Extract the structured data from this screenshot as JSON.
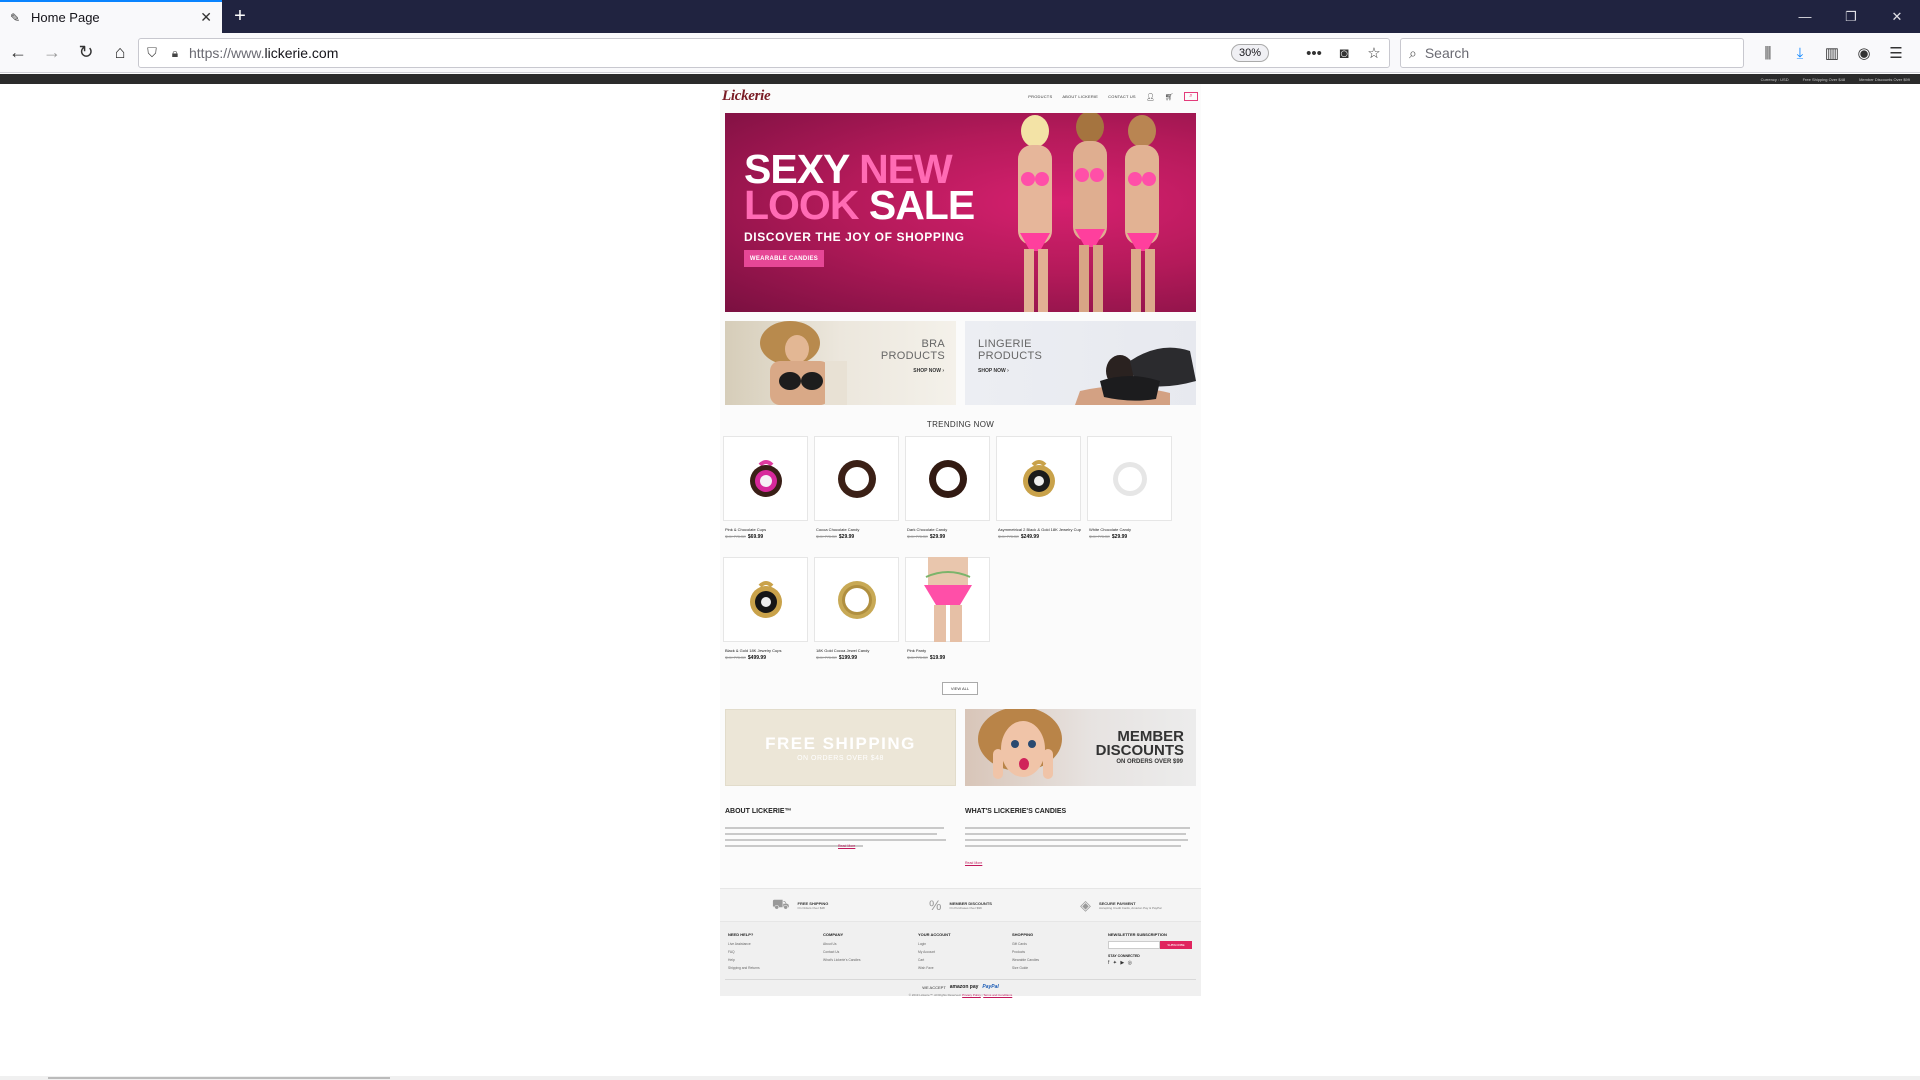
{
  "browser": {
    "tab_title": "Home Page",
    "url_prefix": "https://www.",
    "url_domain": "lickerie.com",
    "zoom": "30%",
    "search_placeholder": "Search"
  },
  "topbar": {
    "currency": "Currency : USD",
    "free_shipping": "Free Shipping Over $48",
    "member_discounts": "Member Discounts Over $99"
  },
  "site": {
    "logo": "Lickerie",
    "nav": [
      "PRODUCTS",
      "ABOUT LICKERIE",
      "CONTACT US"
    ],
    "hero": {
      "line1_a": "SEXY",
      "line1_b": "NEW",
      "line2_a": "LOOK",
      "line2_b": "SALE",
      "tagline": "DISCOVER THE JOY OF SHOPPING",
      "cta": "WEARABLE CANDIES"
    },
    "categories": [
      {
        "line1": "BRA",
        "line2": "PRODUCTS",
        "cta": "SHOP NOW ›"
      },
      {
        "line1": "LINGERIE",
        "line2": "PRODUCTS",
        "cta": "SHOP NOW ›"
      }
    ],
    "trending_title": "TRENDING NOW",
    "products": [
      {
        "name": "Pink & Chocolate Cups",
        "old": "$XX PRICE",
        "price": "$69.99"
      },
      {
        "name": "Cocoa Chocolate Candy",
        "old": "$XX PRICE",
        "price": "$29.99"
      },
      {
        "name": "Dark Chocolate Candy",
        "old": "$XX PRICE",
        "price": "$29.99"
      },
      {
        "name": "Asymmetrical 2 Black & Gold 18K Jewelry Cup",
        "old": "$XX PRICE",
        "price": "$249.99"
      },
      {
        "name": "White Chocolate Candy",
        "old": "$XX PRICE",
        "price": "$29.99"
      },
      {
        "name": "Black & Gold 18K Jewelry Cups",
        "old": "$XX PRICE",
        "price": "$499.99"
      },
      {
        "name": "18K Gold Cocoa Jewel Candy",
        "old": "$XX PRICE",
        "price": "$199.99"
      },
      {
        "name": "Pink Panty",
        "old": "$XX PRICE",
        "price": "$19.99"
      }
    ],
    "view_all": "VIEW ALL",
    "promos": {
      "shipping_title": "FREE SHIPPING",
      "shipping_sub": "ON ORDERS OVER $48",
      "member_line1": "MEMBER",
      "member_line2": "DISCOUNTS",
      "member_sub": "ON ORDERS OVER $99"
    },
    "about": [
      {
        "title": "ABOUT LICKERIE™",
        "more": "Read More"
      },
      {
        "title": "WHAT'S LICKERIE'S CANDIES",
        "more": "Read More"
      }
    ],
    "features": [
      {
        "title": "FREE SHIPPING",
        "sub": "On Orders Over $48"
      },
      {
        "title": "MEMBER DISCOUNTS",
        "sub": "On Purchases Over $99"
      },
      {
        "title": "SECURE PAYMENT",
        "sub": "Accepting Credit Cards, Amazon Pay & PayPal"
      }
    ],
    "footer": {
      "columns": [
        {
          "title": "NEED HELP?",
          "links": [
            "Live Assistance",
            "FAQ",
            "Help",
            "Shipping and Returns"
          ]
        },
        {
          "title": "COMPANY",
          "links": [
            "About Us",
            "Contact Us",
            "What's Lickerie's Candies"
          ]
        },
        {
          "title": "YOUR ACCOUNT",
          "links": [
            "Login",
            "My Account",
            "Cart",
            "Wish Fave"
          ]
        },
        {
          "title": "SHOPPING",
          "links": [
            "Gift Cards",
            "Products",
            "Wearable Candies",
            "Size Guide"
          ]
        }
      ],
      "newsletter_title": "NEWSLETTER SUBSCRIPTION",
      "subscribe": "SUBSCRIBE",
      "stay_connected": "STAY CONNECTED",
      "social": "f ✦ ▶ ◎",
      "we_accept": "WE ACCEPT",
      "amazon": "amazon pay",
      "paypal": "PayPal",
      "copyright": "© 2019 Lickerie™. All Rights Reserved.",
      "privacy": "Privacy Policy",
      "terms": "Terms and Conditions"
    }
  }
}
